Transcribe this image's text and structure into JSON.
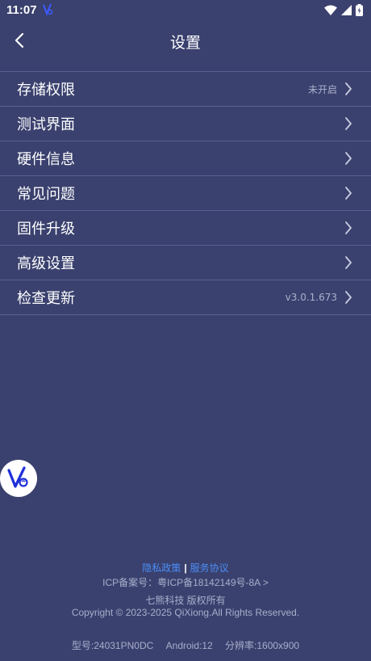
{
  "status_bar": {
    "time": "11:07"
  },
  "header": {
    "title": "设置"
  },
  "menu": {
    "items": [
      {
        "label": "存储权限",
        "value": "未开启"
      },
      {
        "label": "测试界面",
        "value": ""
      },
      {
        "label": "硬件信息",
        "value": ""
      },
      {
        "label": "常见问题",
        "value": ""
      },
      {
        "label": "固件升级",
        "value": ""
      },
      {
        "label": "高级设置",
        "value": ""
      },
      {
        "label": "检查更新",
        "value": "v3.0.1.673"
      }
    ]
  },
  "footer": {
    "privacy_policy": "隐私政策",
    "separator": "|",
    "service_agreement": "服务协议",
    "icp": "ICP备案号：粤ICP备18142149号-8A >",
    "company": "七熊科技  版权所有",
    "copyright": "Copyright © 2023-2025 QiXiong.All Rights Reserved.",
    "model": "型号:24031PN0DC",
    "android": "Android:12",
    "resolution": "分辨率:1600x900"
  },
  "colors": {
    "background": "#3a416e",
    "divider": "#5a6190",
    "link": "#4c8df5",
    "muted_text": "#a8aecb"
  }
}
